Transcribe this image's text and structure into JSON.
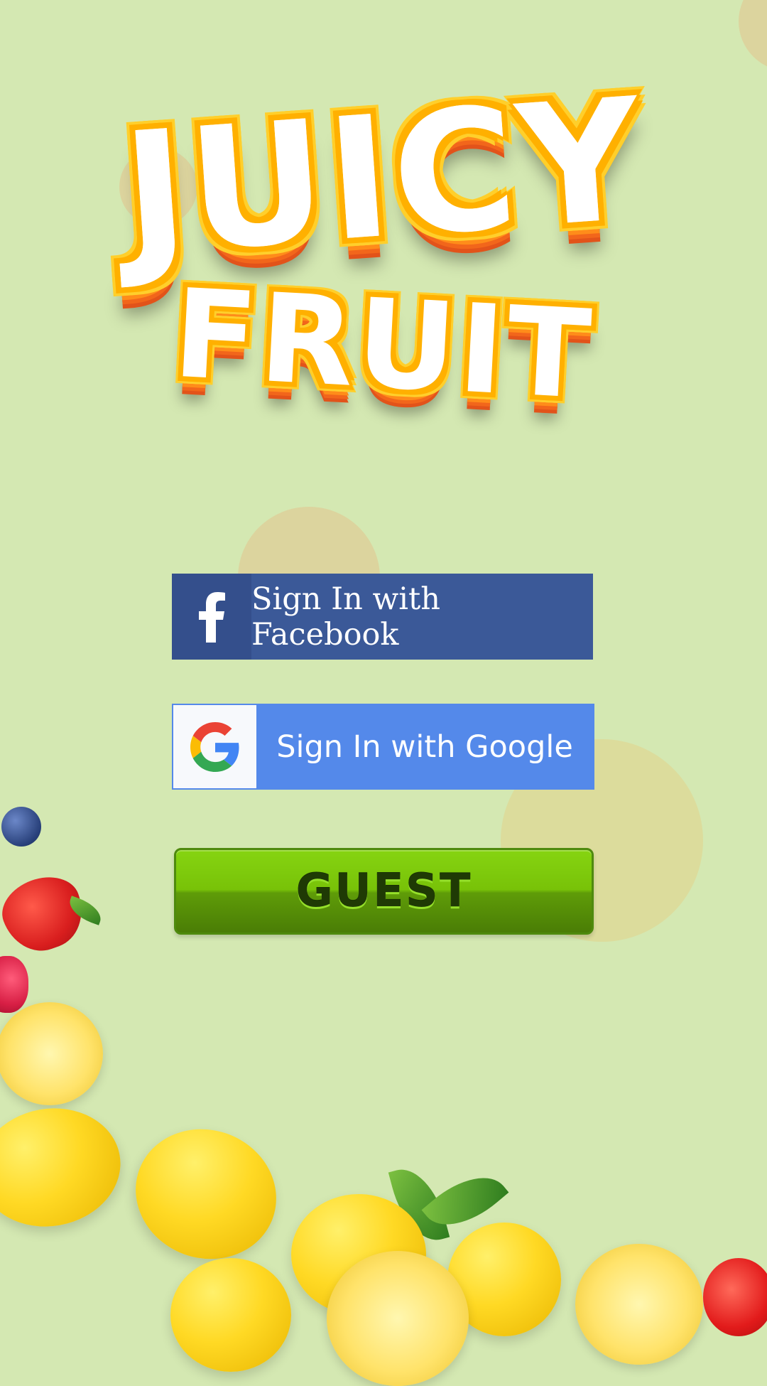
{
  "app": {
    "title_line1": "JUICY",
    "title_line2": "FRUIT"
  },
  "buttons": {
    "facebook_label": "Sign In with Facebook",
    "google_label": "Sign In with Google",
    "guest_label": "GUEST"
  },
  "colors": {
    "background": "#d4e8b2",
    "facebook": "#3b5998",
    "google": "#5489ea",
    "guest": "#78c208"
  },
  "icons": {
    "facebook": "facebook-icon",
    "google": "google-icon"
  }
}
